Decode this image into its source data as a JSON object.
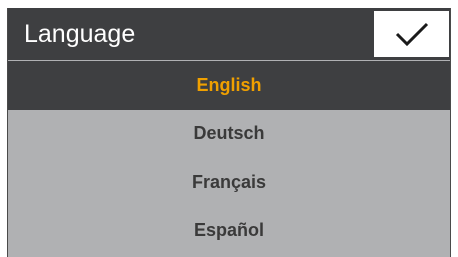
{
  "header": {
    "title": "Language",
    "confirm_icon": "checkmark-icon"
  },
  "languages": [
    {
      "label": "English",
      "selected": true
    },
    {
      "label": "Deutsch",
      "selected": false
    },
    {
      "label": "Français",
      "selected": false
    },
    {
      "label": "Español",
      "selected": false
    }
  ],
  "colors": {
    "header_bg": "#3e3f41",
    "list_bg": "#b0b1b3",
    "selected_text": "#f0a000",
    "text": "#3a3a3a"
  }
}
